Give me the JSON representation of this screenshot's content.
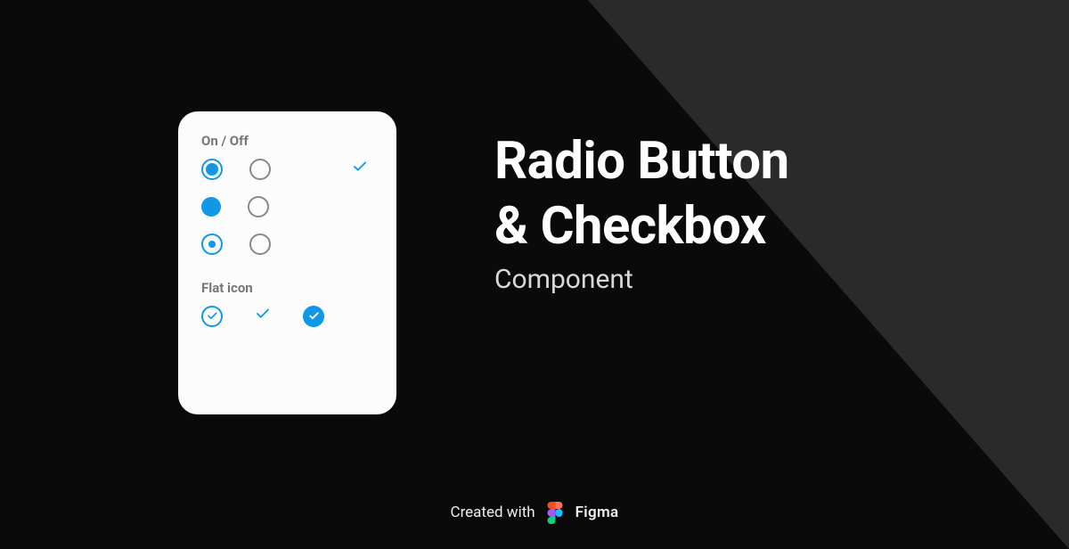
{
  "card": {
    "section1_label": "On / Off",
    "section2_label": "Flat icon"
  },
  "headline": {
    "line1": "Radio Button",
    "line2": "& Checkbox",
    "subtitle": "Component"
  },
  "footer": {
    "created": "Created  with",
    "brand": "Figma"
  },
  "colors": {
    "accent": "#0f98e8",
    "bg_dark": "#0a0a0a",
    "bg_diag": "#2a2a2a",
    "card_bg": "#fcfcfc"
  }
}
